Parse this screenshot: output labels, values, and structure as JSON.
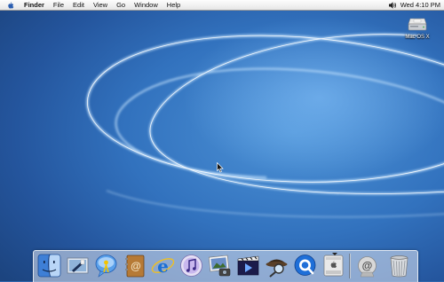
{
  "menubar": {
    "app_name": "Finder",
    "menus": [
      "File",
      "Edit",
      "View",
      "Go",
      "Window",
      "Help"
    ],
    "clock": "Wed 4:10 PM",
    "apple_icon": "apple-icon",
    "volume_icon": "volume-icon"
  },
  "desktop": {
    "drive_label": "Mac OS X",
    "drive_icon": "hard-drive-icon"
  },
  "dock": {
    "items": [
      {
        "name": "finder",
        "icon": "finder-icon"
      },
      {
        "name": "mail",
        "icon": "mail-icon"
      },
      {
        "name": "ichat",
        "icon": "ichat-icon"
      },
      {
        "name": "address-book",
        "icon": "address-book-icon"
      },
      {
        "name": "internet-explorer",
        "icon": "internet-explorer-icon"
      },
      {
        "name": "itunes",
        "icon": "itunes-icon"
      },
      {
        "name": "iphoto",
        "icon": "iphoto-icon"
      },
      {
        "name": "imovie",
        "icon": "imovie-icon"
      },
      {
        "name": "sherlock",
        "icon": "sherlock-icon"
      },
      {
        "name": "quicktime",
        "icon": "quicktime-icon"
      },
      {
        "name": "system-preferences",
        "icon": "system-preferences-icon"
      },
      {
        "name": "url-link",
        "icon": "at-sign-icon"
      },
      {
        "name": "trash",
        "icon": "trash-icon"
      }
    ]
  },
  "colors": {
    "desktop_blue": "#2f66ad",
    "menubar": "#eeeeee"
  }
}
